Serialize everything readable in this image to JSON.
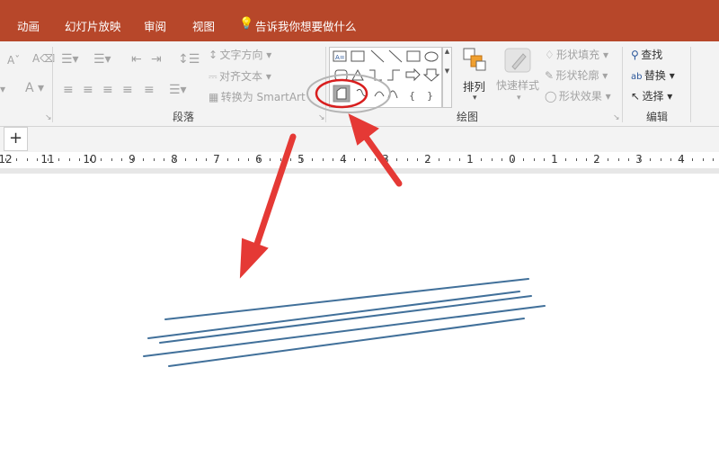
{
  "tabs": [
    "动画",
    "幻灯片放映",
    "审阅",
    "视图"
  ],
  "tell_me": "告诉我你想要做什么",
  "paragraph": {
    "text_direction": "文字方向",
    "align_text": "对齐文本",
    "convert_smartart": "转换为 SmartArt",
    "group_label": "段落"
  },
  "drawing": {
    "arrange": "排列",
    "quick_styles": "快速样式",
    "shape_fill": "形状填充",
    "shape_outline": "形状轮廓",
    "shape_effects": "形状效果",
    "group_label": "绘图"
  },
  "editing": {
    "find": "查找",
    "replace": "替换",
    "select": "选择",
    "group_label": "编辑"
  },
  "add_button": "+",
  "ruler_labels": [
    "12",
    "11",
    "10",
    "9",
    "8",
    "7",
    "6",
    "5",
    "4",
    "3",
    "2",
    "1",
    "0",
    "1",
    "2",
    "3",
    "4"
  ],
  "colors": {
    "accent": "#b7472a",
    "annotation_red": "#e53935",
    "line_blue": "#41709a"
  }
}
